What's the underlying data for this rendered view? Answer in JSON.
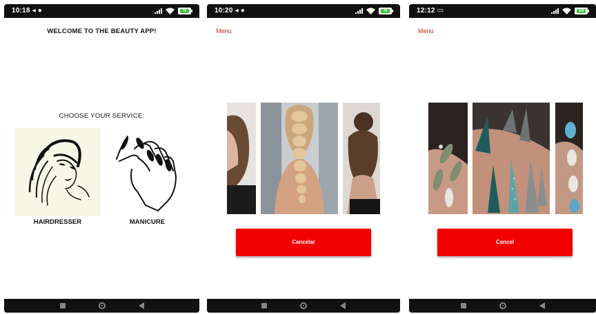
{
  "screen1": {
    "status": {
      "time": "10:18",
      "glyphs": "◂ ●",
      "battery": "78"
    },
    "welcome": "WELCOME TO THE BEAUTY APP!",
    "choose": "CHOOSE YOUR SERVICE:",
    "services": [
      {
        "label": "HAIRDRESSER",
        "icon": "hairdresser-illustration"
      },
      {
        "label": "MANICURE",
        "icon": "manicure-illustration"
      }
    ]
  },
  "screen2": {
    "status": {
      "time": "10:20",
      "glyphs": "◂ ●",
      "battery": "78"
    },
    "menu": "Menu",
    "gallery": [
      "hair-photo-bob",
      "hair-photo-braid",
      "hair-photo-bun"
    ],
    "button": "Cancelar"
  },
  "screen3": {
    "status": {
      "time": "12:12",
      "glyphs": "▭",
      "battery": "100"
    },
    "menu": "Menu",
    "gallery": [
      "nails-photo-green",
      "nails-photo-teal",
      "nails-photo-glitter"
    ],
    "button": "Cancel"
  },
  "colors": {
    "accent_red": "#f20000",
    "menu_red": "#d0261c",
    "status_bar": "#101010"
  }
}
